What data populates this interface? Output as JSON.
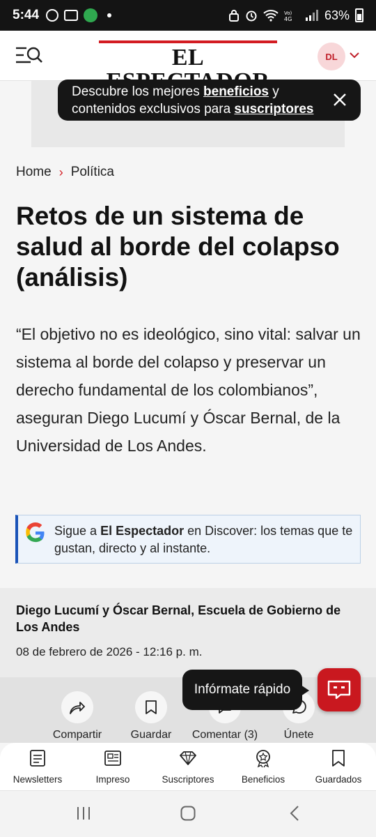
{
  "status_bar": {
    "time": "5:44",
    "battery": "63%"
  },
  "header": {
    "logo": "EL ESPECTADOR",
    "avatar_initials": "DL",
    "brand_color": "#d31c22"
  },
  "toast": {
    "line1_pre": "Descubre los mejores ",
    "line1_link": "beneficios",
    "line1_post": " y",
    "line2_pre": "contenidos exclusivos para ",
    "line2_link": "suscriptores"
  },
  "breadcrumb": {
    "home": "Home",
    "section": "Política"
  },
  "article": {
    "title": "Retos de un sistema de salud al borde del colapso (análisis)",
    "lead": "“El objetivo no es ideológico, sino vital: salvar un sistema al borde del colapso y preservar un derecho fundamental de los colombianos”, aseguran Diego Lucumí y Óscar Bernal, de la Universidad de Los Andes."
  },
  "discover": {
    "pre": "Sigue a ",
    "brand": "El Espectador",
    "post": " en Discover: los temas que te gustan, directo y al instante."
  },
  "author": {
    "names": "Diego Lucumí y Óscar Bernal, Escuela de Gobierno de Los Andes",
    "date": "08 de febrero de 2026 - 12:16 p. m."
  },
  "share": {
    "share_label": "Compartir",
    "save_label": "Guardar",
    "comment_label": "Comentar (3)",
    "join_label": "Únete"
  },
  "quick": {
    "tooltip": "Infórmate rápido"
  },
  "bottom_nav": {
    "newsletters": "Newsletters",
    "impreso": "Impreso",
    "suscriptores": "Suscriptores",
    "beneficios": "Beneficios",
    "guardados": "Guardados"
  }
}
